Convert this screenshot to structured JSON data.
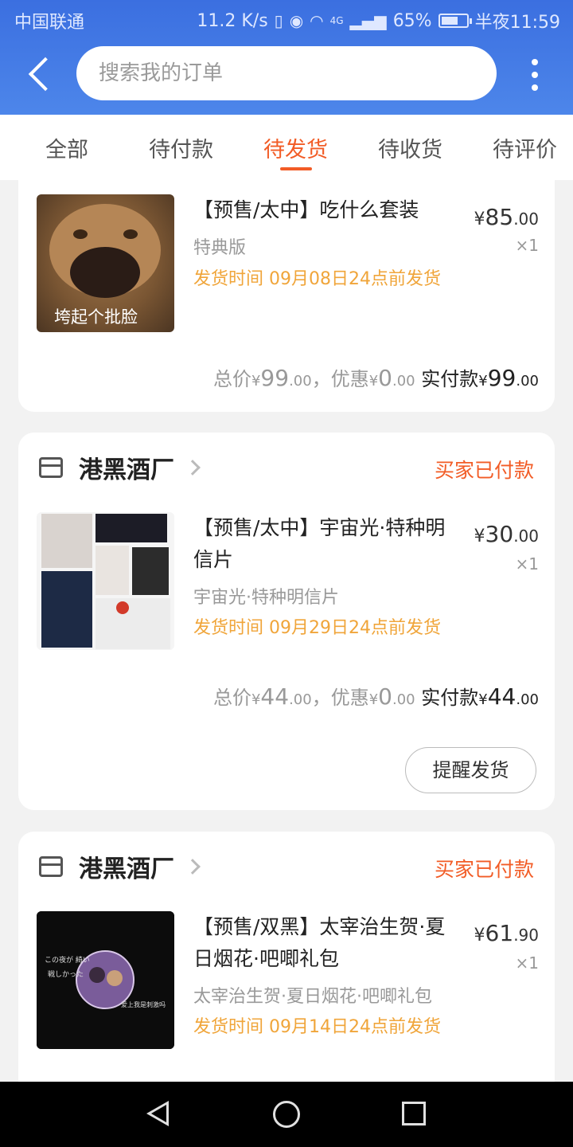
{
  "status_bar": {
    "carrier": "中国联通",
    "speed": "11.2 K/s",
    "network": "4G",
    "battery": "65%",
    "battery_level": 0.65,
    "time": "半夜11:59"
  },
  "header": {
    "search_placeholder": "搜索我的订单"
  },
  "tabs": [
    {
      "label": "全部",
      "active": false
    },
    {
      "label": "待付款",
      "active": false
    },
    {
      "label": "待发货",
      "active": true
    },
    {
      "label": "待收货",
      "active": false
    },
    {
      "label": "待评价",
      "active": false
    }
  ],
  "orders": [
    {
      "item_title": "【预售/太中】吃什么套装",
      "spec": "特典版",
      "ship_time": "发货时间 09月08日24点前发货",
      "price_int": "85",
      "price_dec": ".00",
      "quantity": "×1",
      "thumb_caption": "垮起个批脸",
      "summary": {
        "total_label": "总价",
        "total_int": "99",
        "total_dec": ".00",
        "discount_label": "，优惠",
        "discount_int": "0",
        "discount_dec": ".00",
        "paid_label": "实付款",
        "paid_int": "99",
        "paid_dec": ".00"
      }
    },
    {
      "store_name": "港黑酒厂",
      "status": "买家已付款",
      "item_title": "【预售/太中】宇宙光·特种明信片",
      "spec": "宇宙光·特种明信片",
      "ship_time": "发货时间 09月29日24点前发货",
      "price_int": "30",
      "price_dec": ".00",
      "quantity": "×1",
      "summary": {
        "total_label": "总价",
        "total_int": "44",
        "total_dec": ".00",
        "discount_label": "，优惠",
        "discount_int": "0",
        "discount_dec": ".00",
        "paid_label": "实付款",
        "paid_int": "44",
        "paid_dec": ".00"
      },
      "action_button": "提醒发货"
    },
    {
      "store_name": "港黑酒厂",
      "status": "买家已付款",
      "item_title": "【预售/双黑】太宰治生贺·夏日烟花·吧唧礼包",
      "spec": "太宰治生贺·夏日烟花·吧唧礼包",
      "ship_time": "发货时间 09月14日24点前发货",
      "price_int": "61",
      "price_dec": ".90",
      "quantity": "×1",
      "thumb_text_1": "この夜が 綺い",
      "thumb_text_2": "戦しかった",
      "thumb_text_3": "爱上我是刺激吗"
    }
  ],
  "currency": "¥",
  "colors": {
    "accent": "#f25c26",
    "header_blue": "#4679e6",
    "ship_orange": "#f0a53a"
  }
}
